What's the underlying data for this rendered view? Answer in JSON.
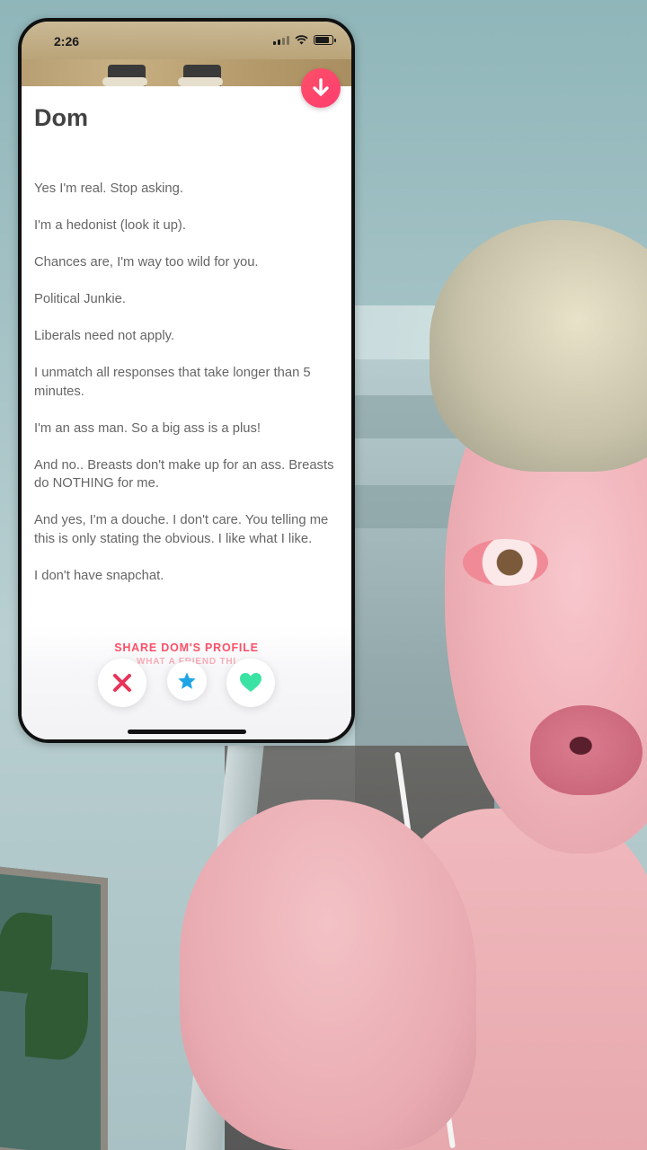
{
  "status_bar": {
    "time": "2:26",
    "signal_bars": 2,
    "battery_level": 0.85
  },
  "profile": {
    "name": "Dom",
    "bio": [
      "Yes I'm real. Stop asking.",
      "I'm a hedonist (look it up).",
      "Chances are, I'm way too wild for you.",
      "Political Junkie.",
      "Liberals need not apply.",
      "I unmatch all responses that take longer than 5 minutes.",
      "I'm an ass man. So a big ass is a plus!",
      "And no.. Breasts don't make up for an ass. Breasts do NOTHING for me.",
      "And yes, I'm a douche. I don't care. You telling me this is only stating the obvious. I like what I like.",
      "I don't have snapchat."
    ],
    "share_label": "SHARE DOM'S PROFILE",
    "share_sublabel": "WHAT A FRIEND THI"
  },
  "actions": {
    "collapse_icon": "arrow-down-icon",
    "nope_icon": "x-icon",
    "superlike_icon": "star-icon",
    "like_icon": "heart-icon"
  },
  "colors": {
    "brand": "#fd5068",
    "nope": "#e8345a",
    "superlike": "#1ea5e6",
    "like": "#3ae3a3",
    "text_primary": "#424242",
    "text_secondary": "#666666"
  }
}
